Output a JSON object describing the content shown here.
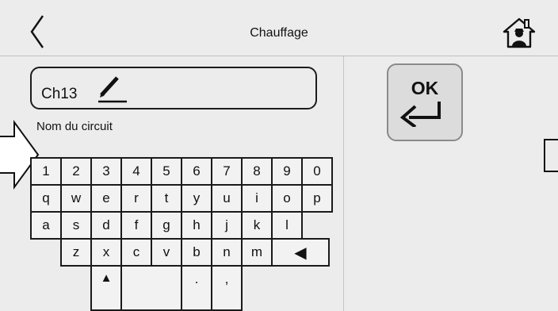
{
  "header": {
    "title": "Chauffage",
    "back_icon": "chevron-left-icon",
    "home_icon": "home-person-icon"
  },
  "editor": {
    "value": "Ch13",
    "label": "Nom du circuit",
    "pencil_icon": "pencil-icon"
  },
  "ok_button": {
    "label": "OK",
    "icon": "enter-arrow-icon"
  },
  "keyboard": {
    "rows": [
      [
        "1",
        "2",
        "3",
        "4",
        "5",
        "6",
        "7",
        "8",
        "9",
        "0"
      ],
      [
        "q",
        "w",
        "e",
        "r",
        "t",
        "y",
        "u",
        "i",
        "o",
        "p"
      ],
      [
        "a",
        "s",
        "d",
        "f",
        "g",
        "h",
        "j",
        "k",
        "l"
      ],
      [
        "z",
        "x",
        "c",
        "v",
        "b",
        "n",
        "m",
        "◀"
      ],
      [
        "▲",
        "",
        ".",
        ","
      ]
    ]
  }
}
